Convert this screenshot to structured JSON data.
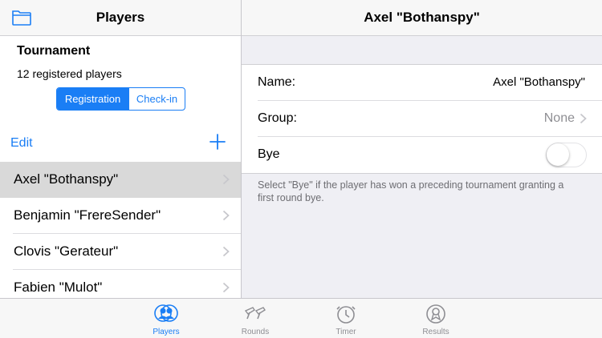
{
  "colors": {
    "accent": "#1a7ef5",
    "muted": "#8e8e93"
  },
  "left": {
    "nav_title": "Players",
    "folder_icon": "folder-icon",
    "tournament_title": "Tournament",
    "registered_count": "12 registered players",
    "segments": {
      "registration": "Registration",
      "checkin": "Check-in",
      "selected": "Registration"
    },
    "edit_label": "Edit",
    "add_icon": "plus-icon",
    "players": [
      {
        "name": "Axel \"Bothanspy\"",
        "selected": true
      },
      {
        "name": "Benjamin \"FrereSender\"",
        "selected": false
      },
      {
        "name": "Clovis \"Gerateur\"",
        "selected": false
      },
      {
        "name": "Fabien \"Mulot\"",
        "selected": false
      }
    ]
  },
  "right": {
    "nav_title": "Axel \"Bothanspy\"",
    "name_label": "Name:",
    "name_value": "Axel \"Bothanspy\"",
    "group_label": "Group:",
    "group_value": "None",
    "bye_label": "Bye",
    "bye_on": false,
    "bye_note": "Select \"Bye\" if the player has won a preceding tournament granting a first round bye."
  },
  "tabs": [
    {
      "label": "Players",
      "icon": "players-icon",
      "active": true
    },
    {
      "label": "Rounds",
      "icon": "rounds-icon",
      "active": false
    },
    {
      "label": "Timer",
      "icon": "timer-icon",
      "active": false
    },
    {
      "label": "Results",
      "icon": "results-icon",
      "active": false
    }
  ]
}
